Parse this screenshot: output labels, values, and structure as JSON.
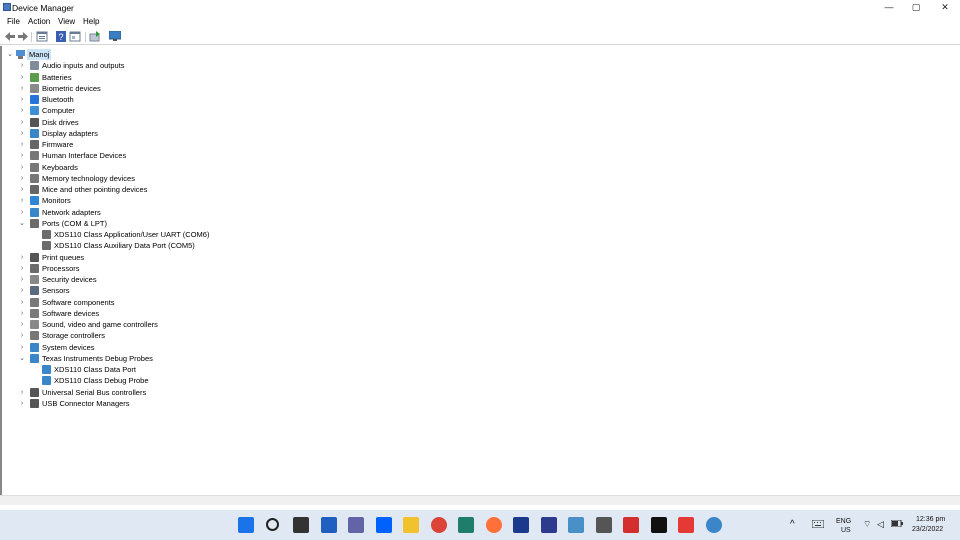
{
  "window": {
    "title": "Device Manager",
    "controls": {
      "minimize": "—",
      "maximize": "▢",
      "close": "✕"
    }
  },
  "menu": [
    "File",
    "Action",
    "View",
    "Help"
  ],
  "toolbar": {
    "buttons": [
      "back-icon",
      "forward-icon",
      "properties-icon",
      "help-icon",
      "show-hidden-icon",
      "update-driver-icon",
      "monitor-icon"
    ]
  },
  "tree": {
    "root": "Manoj",
    "categories": [
      {
        "label": "Audio inputs and outputs",
        "icon": "speaker-icon",
        "expanded": false
      },
      {
        "label": "Batteries",
        "icon": "battery-icon",
        "expanded": false
      },
      {
        "label": "Biometric devices",
        "icon": "biometric-icon",
        "expanded": false
      },
      {
        "label": "Bluetooth",
        "icon": "bluetooth-icon",
        "expanded": false
      },
      {
        "label": "Computer",
        "icon": "computer-icon",
        "expanded": false
      },
      {
        "label": "Disk drives",
        "icon": "disk-icon",
        "expanded": false
      },
      {
        "label": "Display adapters",
        "icon": "display-icon",
        "expanded": false
      },
      {
        "label": "Firmware",
        "icon": "firmware-icon",
        "expanded": false
      },
      {
        "label": "Human Interface Devices",
        "icon": "hid-icon",
        "expanded": false
      },
      {
        "label": "Keyboards",
        "icon": "keyboard-icon",
        "expanded": false
      },
      {
        "label": "Memory technology devices",
        "icon": "memory-icon",
        "expanded": false
      },
      {
        "label": "Mice and other pointing devices",
        "icon": "mouse-icon",
        "expanded": false
      },
      {
        "label": "Monitors",
        "icon": "monitor-icon",
        "expanded": false
      },
      {
        "label": "Network adapters",
        "icon": "network-icon",
        "expanded": false
      },
      {
        "label": "Ports (COM & LPT)",
        "icon": "port-icon",
        "expanded": true,
        "children": [
          "XDS110 Class Application/User UART (COM6)",
          "XDS110 Class Auxiliary Data Port (COM5)"
        ]
      },
      {
        "label": "Print queues",
        "icon": "printer-icon",
        "expanded": false
      },
      {
        "label": "Processors",
        "icon": "processor-icon",
        "expanded": false
      },
      {
        "label": "Security devices",
        "icon": "security-icon",
        "expanded": false
      },
      {
        "label": "Sensors",
        "icon": "sensor-icon",
        "expanded": false
      },
      {
        "label": "Software components",
        "icon": "software-component-icon",
        "expanded": false
      },
      {
        "label": "Software devices",
        "icon": "software-device-icon",
        "expanded": false
      },
      {
        "label": "Sound, video and game controllers",
        "icon": "sound-icon",
        "expanded": false
      },
      {
        "label": "Storage controllers",
        "icon": "storage-icon",
        "expanded": false
      },
      {
        "label": "System devices",
        "icon": "system-icon",
        "expanded": false
      },
      {
        "label": "Texas Instruments Debug Probes",
        "icon": "debug-probe-icon",
        "expanded": true,
        "children": [
          "XDS110 Class Data Port",
          "XDS110 Class Debug Probe"
        ]
      },
      {
        "label": "Universal Serial Bus controllers",
        "icon": "usb-icon",
        "expanded": false
      },
      {
        "label": "USB Connector Managers",
        "icon": "usb-icon",
        "expanded": false
      }
    ]
  },
  "taskbar": {
    "apps": [
      "start-icon",
      "search-icon",
      "task-view-icon",
      "widgets-icon",
      "teams-icon",
      "dropbox-icon",
      "file-explorer-icon",
      "chrome-icon",
      "sublime-icon",
      "firefox-icon",
      "app-s-icon",
      "app-pen-icon",
      "snipping-icon",
      "device-manager-icon",
      "acrobat-icon",
      "terminal-icon",
      "flash-icon",
      "globe-icon"
    ],
    "tray": {
      "language": "ENG",
      "region": "US",
      "time": "12:36 pm",
      "date": "23/2/2022"
    }
  }
}
